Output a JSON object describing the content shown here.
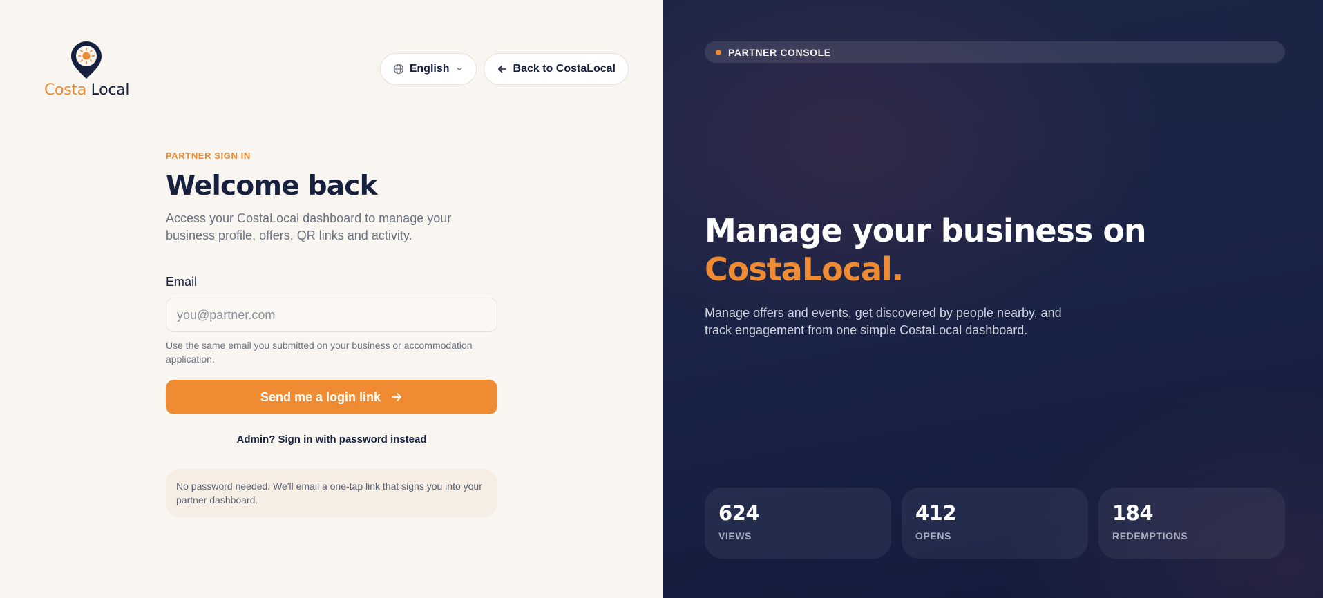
{
  "brand": {
    "name_part1": "Costa",
    "name_part2": "Local",
    "accent_color": "#ee8a32",
    "navy_color": "#17213f"
  },
  "header": {
    "language_label": "English",
    "back_label": "Back to CostaLocal"
  },
  "form": {
    "eyebrow": "PARTNER SIGN IN",
    "title": "Welcome back",
    "subtitle": "Access your CostaLocal dashboard to manage your business profile, offers, QR links and activity.",
    "email_label": "Email",
    "email_placeholder": "you@partner.com",
    "email_value": "",
    "email_help": "Use the same email you submitted on your business or accommodation application.",
    "submit_label": "Send me a login link",
    "admin_link": "Admin? Sign in with password instead",
    "note": "No password needed. We'll email a one-tap link that signs you into your partner dashboard."
  },
  "promo": {
    "badge": "PARTNER CONSOLE",
    "headline_line1": "Manage your business on",
    "headline_line2": "CostaLocal.",
    "subtitle": "Manage offers and events, get discovered by people nearby, and track engagement from one simple CostaLocal dashboard.",
    "stats": [
      {
        "value": "624",
        "label": "VIEWS"
      },
      {
        "value": "412",
        "label": "OPENS"
      },
      {
        "value": "184",
        "label": "REDEMPTIONS"
      }
    ]
  }
}
